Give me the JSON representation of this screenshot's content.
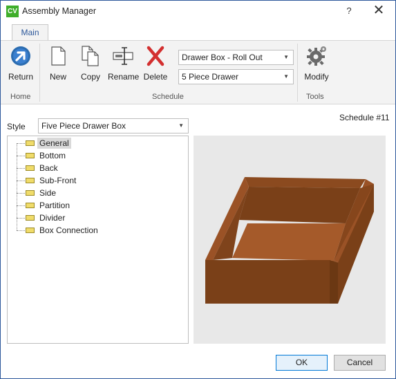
{
  "window": {
    "app_icon_text": "CV",
    "title": "Assembly Manager",
    "help_label": "?",
    "close_label": "✕"
  },
  "ribbon": {
    "tabs": [
      {
        "label": "Main",
        "active": true
      }
    ],
    "groups": {
      "home": {
        "label": "Home",
        "buttons": [
          {
            "label": "Return",
            "icon": "return-arrow-icon"
          }
        ]
      },
      "schedule": {
        "label": "Schedule",
        "buttons": [
          {
            "label": "New",
            "icon": "new-document-icon"
          },
          {
            "label": "Copy",
            "icon": "copy-icon"
          },
          {
            "label": "Rename",
            "icon": "rename-icon"
          },
          {
            "label": "Delete",
            "icon": "delete-x-icon"
          }
        ],
        "combo_box_type": "Drawer Box - Roll Out",
        "combo_drawer_type": "5 Piece Drawer"
      },
      "tools": {
        "label": "Tools",
        "buttons": [
          {
            "label": "Modify",
            "icon": "gear-icon"
          }
        ]
      }
    }
  },
  "schedule_number": "Schedule #11",
  "style": {
    "label": "Style",
    "value": "Five Piece Drawer Box"
  },
  "tree": {
    "items": [
      {
        "label": "General",
        "selected": true
      },
      {
        "label": "Bottom"
      },
      {
        "label": "Back"
      },
      {
        "label": "Sub-Front"
      },
      {
        "label": "Side"
      },
      {
        "label": "Partition"
      },
      {
        "label": "Divider"
      },
      {
        "label": "Box Connection"
      }
    ]
  },
  "colors": {
    "accent": "#2b579a",
    "app_icon": "#3fae2a",
    "box_dark": "#7a4018",
    "box_mid": "#8b4a1f",
    "box_light": "#a55a2a",
    "delete_red": "#d32f2f",
    "return_blue": "#2b6cb0"
  },
  "footer": {
    "ok_label": "OK",
    "cancel_label": "Cancel"
  }
}
